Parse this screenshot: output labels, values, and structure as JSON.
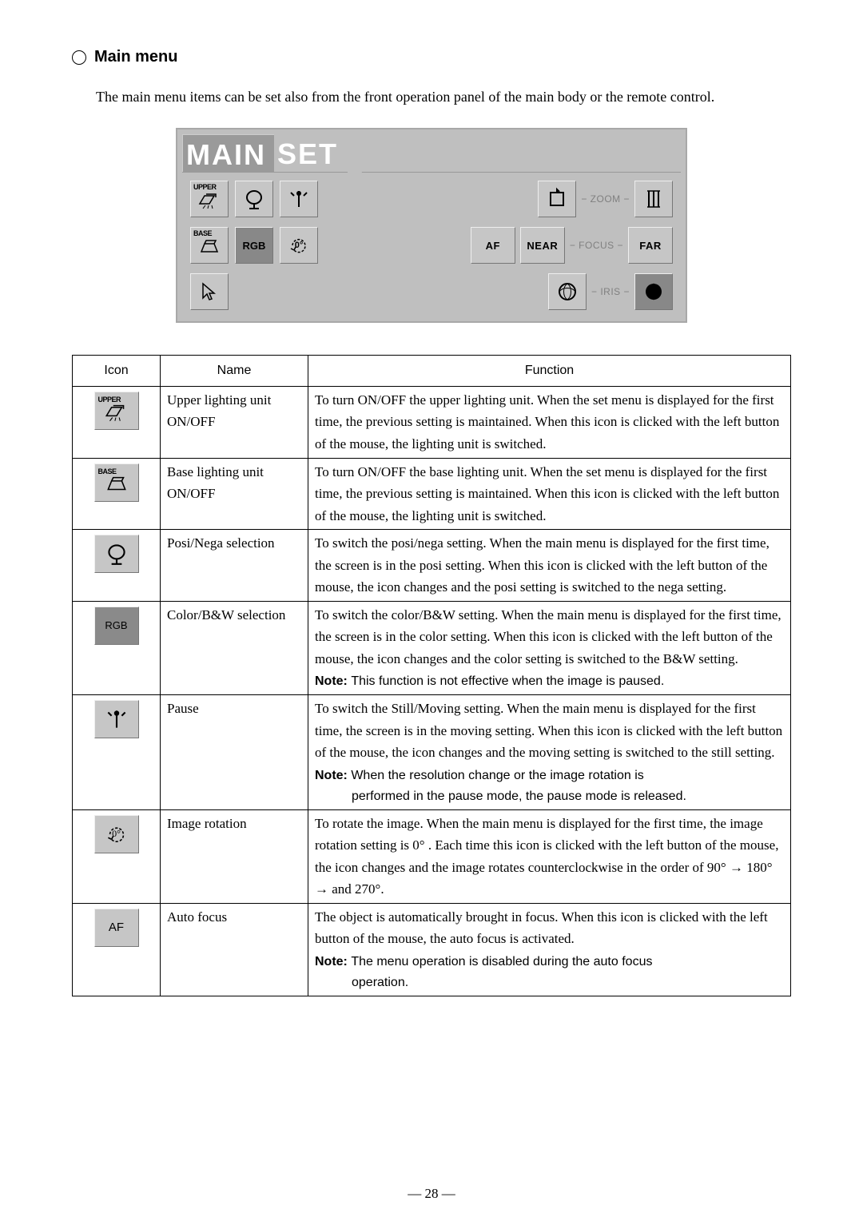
{
  "section_title": "Main menu",
  "intro": "The main menu items can be set also from the front operation panel of the main body or the remote control.",
  "panel": {
    "tab_main": "MAIN",
    "tab_set": "SET",
    "upper_label": "UPPER",
    "base_label": "BASE",
    "rgb_label": "RGB",
    "rotate_label": "0°",
    "af_label": "AF",
    "near_label": "NEAR",
    "far_label": "FAR",
    "zoom_label": "ZOOM",
    "focus_label": "FOCUS",
    "iris_label": "IRIS"
  },
  "table": {
    "headers": {
      "icon": "Icon",
      "name": "Name",
      "function": "Function"
    },
    "rows": [
      {
        "icon_label": "UPPER",
        "icon_kind": "upper",
        "name": "Upper lighting unit ON/OFF",
        "function": "To turn ON/OFF the upper lighting unit.  When the set menu is displayed for the first time, the previous setting is maintained.  When this icon is clicked with the left button of the mouse, the lighting unit is switched."
      },
      {
        "icon_label": "BASE",
        "icon_kind": "base",
        "name": "Base lighting unit ON/OFF",
        "function": "To turn ON/OFF the base lighting unit.  When the set menu is displayed for the first time, the previous setting is maintained.  When this icon is clicked with the left button of the mouse, the lighting unit is switched."
      },
      {
        "icon_label": "",
        "icon_kind": "posinega",
        "name": "Posi/Nega selection",
        "function": "To switch the posi/nega setting.  When the main menu is displayed for the first time, the screen is in the posi setting.  When this icon is clicked with the left button of the mouse, the icon changes and the posi setting is switched to the nega setting."
      },
      {
        "icon_label": "RGB",
        "icon_kind": "rgb",
        "name": "Color/B&W selection",
        "function": "To switch the color/B&W setting.  When the main menu is displayed for the first time, the screen is in the color setting.  When this icon is clicked with the left button of the mouse, the icon changes and the color setting is switched to the B&W setting.",
        "note": "This function is not effective when the image is paused."
      },
      {
        "icon_label": "",
        "icon_kind": "pause",
        "name": "Pause",
        "function": "To switch the Still/Moving setting.  When the main menu is displayed for the first time, the screen is in the moving setting.  When this icon is clicked with the left button of the mouse, the icon changes and the moving setting is switched to the still setting.",
        "note": "When the resolution change or the image rotation is",
        "note_cont": "performed in the pause mode, the pause mode is released."
      },
      {
        "icon_label": "0°",
        "icon_kind": "rotate",
        "name": "Image rotation",
        "function": "To rotate the image.  When the main menu is displayed for the first time, the image rotation setting is 0° . Each time this icon is clicked with the left button of the mouse, the icon changes and the image rotates counterclockwise in the order of 90° → 180° → and 270°."
      },
      {
        "icon_label": "AF",
        "icon_kind": "af",
        "name": "Auto focus",
        "function": "The object is automatically brought in focus.  When this icon is clicked with the left button of the mouse, the auto focus is activated.",
        "note": "The menu operation is disabled during the auto focus",
        "note_cont": "operation."
      }
    ]
  },
  "note_prefix": "Note:",
  "page_number": "— 28 —"
}
